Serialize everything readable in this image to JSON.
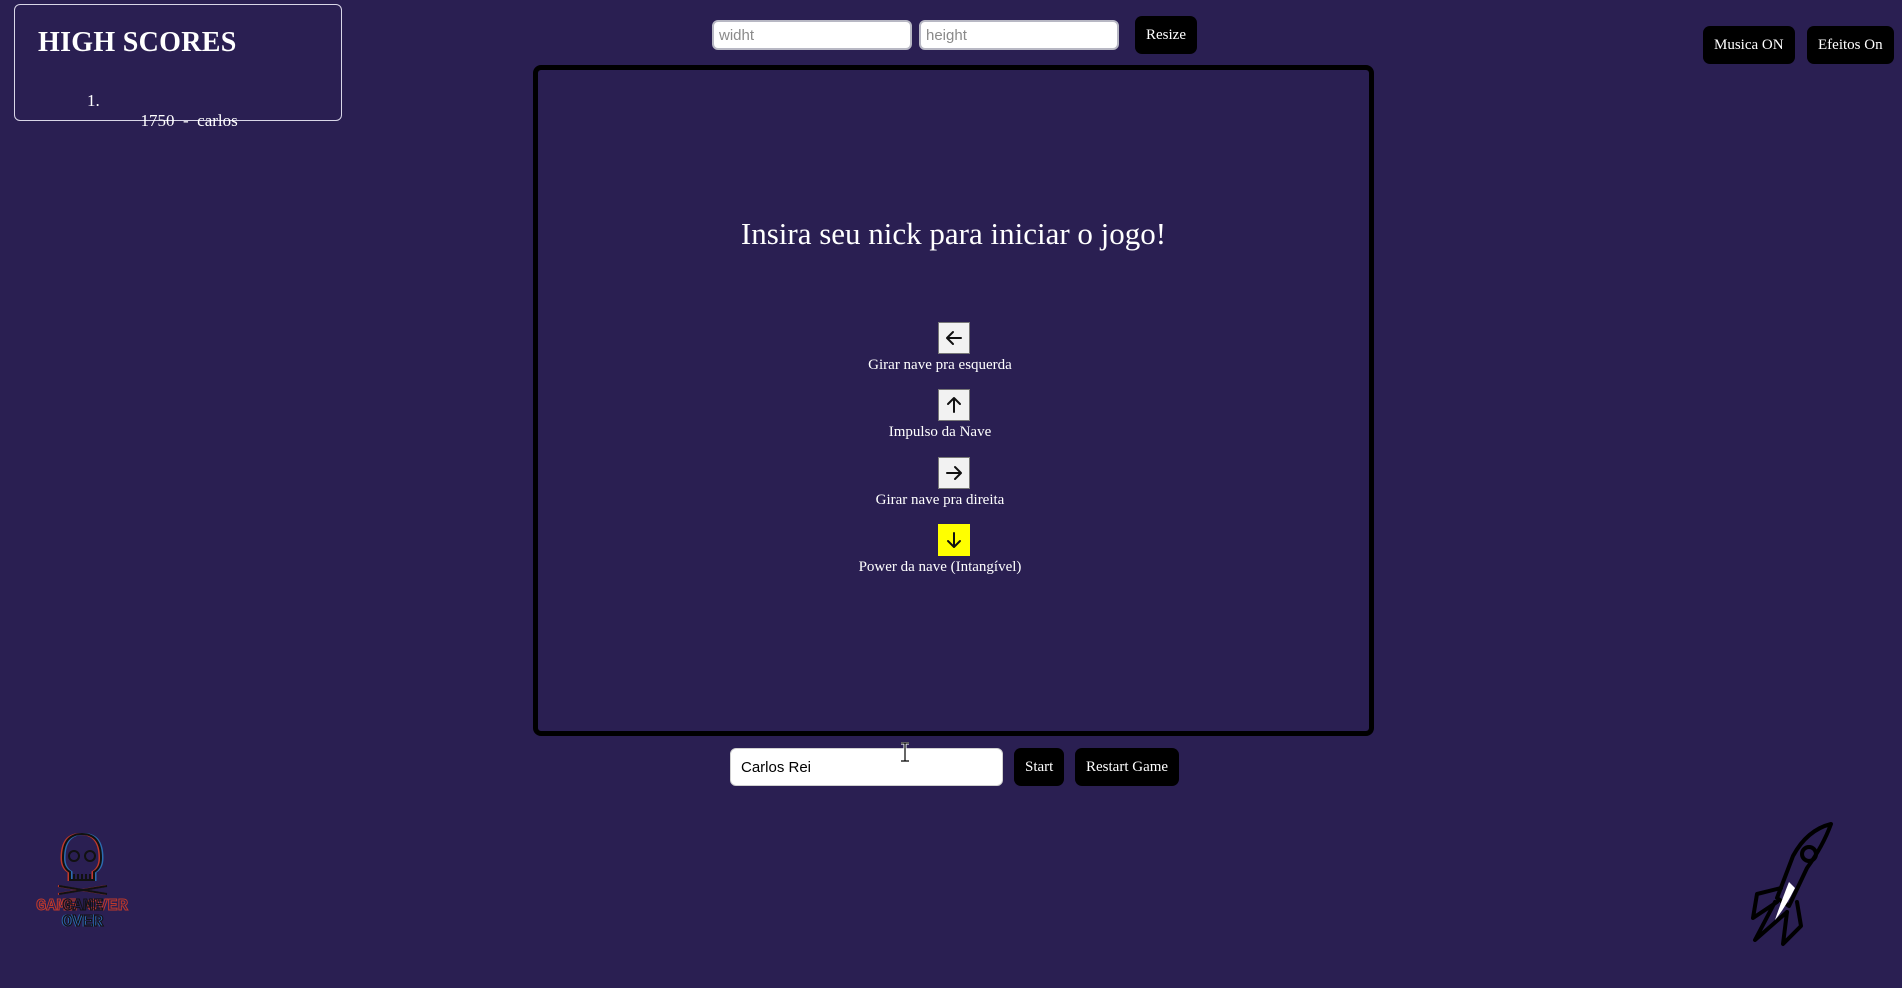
{
  "highscores": {
    "title": "HIGH SCORES",
    "entries": [
      {
        "rank": "1.",
        "text": "1750  -  carlos"
      }
    ]
  },
  "resize": {
    "width_placeholder": "widht",
    "height_placeholder": "height",
    "width_value": "",
    "height_value": "",
    "button_label": "Resize"
  },
  "audio": {
    "music_label": "Musica ON",
    "effects_label": "Efeitos On"
  },
  "game": {
    "prompt": "Insira seu nick para iniciar o jogo!",
    "controls": [
      {
        "icon": "arrow-left-icon",
        "label": "Girar nave pra esquerda"
      },
      {
        "icon": "arrow-up-icon",
        "label": "Impulso da Nave"
      },
      {
        "icon": "arrow-right-icon",
        "label": "Girar nave pra direita"
      },
      {
        "icon": "arrow-down-icon",
        "label": "Power da nave (Intangível)"
      }
    ],
    "power_key_color": "#ffff00"
  },
  "nick": {
    "value": "Carlos Rei"
  },
  "actions": {
    "start_label": "Start",
    "restart_label": "Restart Game"
  },
  "logo_text": "GAME OVER",
  "colors": {
    "background": "#2a1f52",
    "button": "#000000",
    "text": "#ffffff"
  }
}
